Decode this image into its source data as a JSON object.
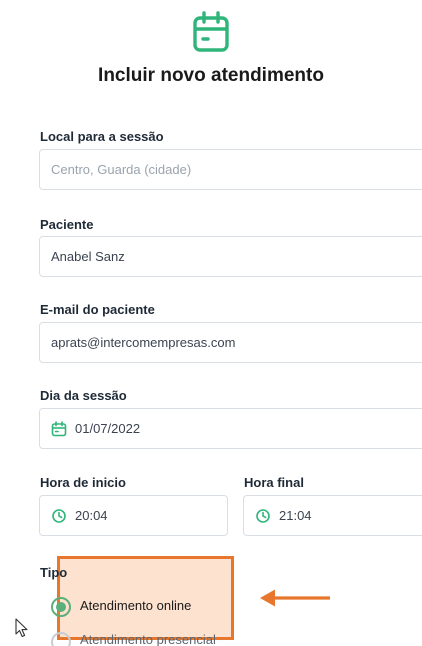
{
  "header": {
    "title": "Incluir novo atendimento",
    "icon": "calendar-icon"
  },
  "form": {
    "local": {
      "label": "Local para a sessão",
      "placeholder": "Centro, Guarda (cidade)",
      "value": ""
    },
    "paciente": {
      "label": "Paciente",
      "value": "Anabel Sanz"
    },
    "email": {
      "label": "E-mail do paciente",
      "value": "aprats@intercomempresas.com"
    },
    "dia": {
      "label": "Dia da sessão",
      "value": "01/07/2022",
      "icon": "calendar-icon"
    },
    "hora_inicio": {
      "label": "Hora de inicio",
      "value": "20:04",
      "icon": "clock-icon"
    },
    "hora_final": {
      "label": "Hora final",
      "value": "21:04",
      "icon": "clock-icon"
    },
    "tipo": {
      "label": "Tipo",
      "options": [
        {
          "label": "Atendimento online",
          "selected": true
        },
        {
          "label": "Atendimento presencial",
          "selected": false
        }
      ]
    }
  },
  "colors": {
    "accent": "#2fb57a",
    "highlight": "#e7772d",
    "highlight_fill": "#fde2cf"
  }
}
